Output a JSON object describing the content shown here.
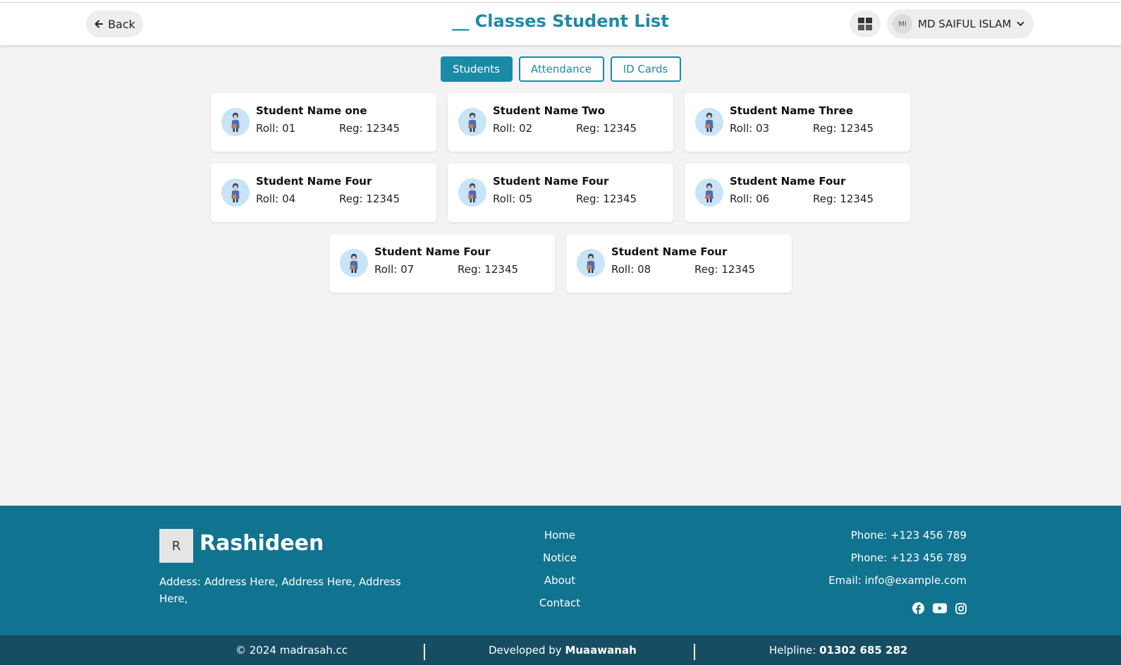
{
  "header": {
    "back_label": "Back",
    "title": "__ Classes Student List",
    "user": {
      "initials": "MI",
      "name": "MD SAIFUL ISLAM"
    }
  },
  "tabs": [
    {
      "label": "Students",
      "active": true
    },
    {
      "label": "Attendance",
      "active": false
    },
    {
      "label": "ID Cards",
      "active": false
    }
  ],
  "students": [
    {
      "name": "Student Name one",
      "roll": "Roll: 01",
      "reg": "Reg: 12345"
    },
    {
      "name": "Student Name Two",
      "roll": "Roll: 02",
      "reg": "Reg: 12345"
    },
    {
      "name": "Student Name Three",
      "roll": "Roll: 03",
      "reg": "Reg: 12345"
    },
    {
      "name": "Student Name Four",
      "roll": "Roll: 04",
      "reg": "Reg: 12345"
    },
    {
      "name": "Student Name Four",
      "roll": "Roll: 05",
      "reg": "Reg: 12345"
    },
    {
      "name": "Student Name Four",
      "roll": "Roll: 06",
      "reg": "Reg: 12345"
    },
    {
      "name": "Student Name Four",
      "roll": "Roll: 07",
      "reg": "Reg: 12345"
    },
    {
      "name": "Student Name Four",
      "roll": "Roll: 08",
      "reg": "Reg: 12345"
    }
  ],
  "footer": {
    "logo_letter": "R",
    "brand": "Rashideen",
    "address": "Addess: Address Here, Address Here, Address Here,",
    "links": [
      "Home",
      "Notice",
      "About",
      "Contact"
    ],
    "contacts": [
      "Phone: +123 456 789",
      "Phone: +123 456 789",
      "Email: info@example.com"
    ],
    "social_icons": [
      "facebook-icon",
      "youtube-icon",
      "instagram-icon"
    ]
  },
  "bottom_bar": {
    "copyright": "© 2024 madrasah.cc",
    "developed_prefix": "Developed by ",
    "developer": "Muaawanah",
    "helpline_prefix": "Helpline: ",
    "helpline": "01302 685 282"
  },
  "colors": {
    "primary": "#1a8aa6",
    "footer_bg": "#10738f",
    "bottom_bar_bg": "#164d62",
    "page_bg": "#f3f3f4"
  }
}
